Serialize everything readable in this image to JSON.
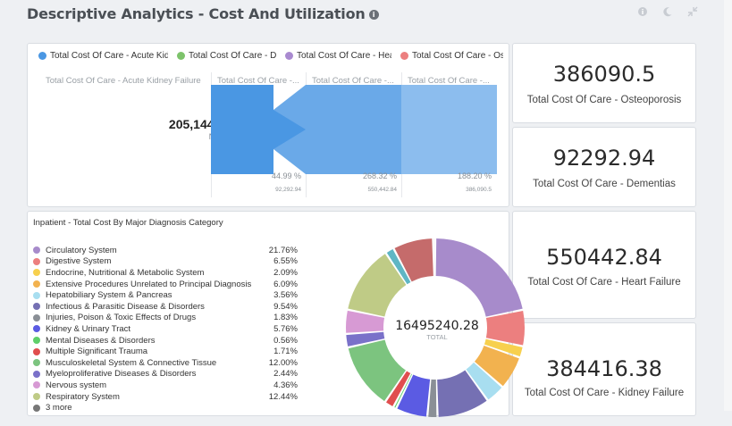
{
  "header": {
    "title": "Descriptive Analytics - Cost And Utilization",
    "info_icon": "i",
    "icons": [
      "info-circle-icon",
      "moon-icon",
      "collapse-icon"
    ]
  },
  "funnel": {
    "legend": [
      {
        "label": "Total Cost Of Care - Acute Kidn",
        "color": "#4a97e3"
      },
      {
        "label": "Total Cost Of Care - De",
        "color": "#7dc36b"
      },
      {
        "label": "Total Cost Of Care - Hear",
        "color": "#a98ad0"
      },
      {
        "label": "Total Cost Of Care - Oste",
        "color": "#ec7f7f"
      }
    ],
    "stage_headers": [
      "Total Cost Of Care - Acute Kidney Failure",
      "Total Cost Of Care -...",
      "Total Cost Of Care -...",
      "Total Cost Of Care -..."
    ],
    "first_value": "205,144.43",
    "first_label": "Name",
    "stages": [
      {
        "pct": "44.99 %",
        "raw": "92,292.94"
      },
      {
        "pct": "268.32 %",
        "raw": "550,442.84"
      },
      {
        "pct": "188.20 %",
        "raw": "386,090.5"
      }
    ]
  },
  "kpis": [
    {
      "value": "386090.5",
      "label": "Total Cost Of Care - Osteoporosis"
    },
    {
      "value": "92292.94",
      "label": "Total Cost Of Care - Dementias"
    },
    {
      "value": "550442.84",
      "label": "Total Cost Of Care - Heart Failure"
    },
    {
      "value": "384416.38",
      "label": "Total Cost Of Care - Kidney Failure"
    }
  ],
  "donut": {
    "title": "Inpatient - Total Cost By Major Diagnosis Category",
    "total": "16495240.28",
    "total_label": "TOTAL",
    "categories": [
      {
        "name": "Circulatory System",
        "value": "21.76%",
        "pct": 21.76,
        "color": "#a78bcb"
      },
      {
        "name": "Digestive System",
        "value": "6.55%",
        "pct": 6.55,
        "color": "#ec7f7f"
      },
      {
        "name": "Endocrine, Nutritional & Metabolic System",
        "value": "2.09%",
        "pct": 2.09,
        "color": "#f7d04e"
      },
      {
        "name": "Extensive Procedures Unrelated to Principal Diagnosis",
        "value": "6.09%",
        "pct": 6.09,
        "color": "#f2b24f"
      },
      {
        "name": "Hepatobiliary System & Pancreas",
        "value": "3.56%",
        "pct": 3.56,
        "color": "#a8def0"
      },
      {
        "name": "Infectious & Parasitic Disease & Disorders",
        "value": "9.54%",
        "pct": 9.54,
        "color": "#7570b3"
      },
      {
        "name": "Injuries, Poison & Toxic Effects of Drugs",
        "value": "1.83%",
        "pct": 1.83,
        "color": "#8a8f96"
      },
      {
        "name": "Kidney & Urinary Tract",
        "value": "5.76%",
        "pct": 5.76,
        "color": "#5b5be3"
      },
      {
        "name": "Mental Diseases & Disorders",
        "value": "0.56%",
        "pct": 0.56,
        "color": "#5fcf6a"
      },
      {
        "name": "Multiple Significant Trauma",
        "value": "1.71%",
        "pct": 1.71,
        "color": "#e04e4e"
      },
      {
        "name": "Musculoskeletal System & Connective Tissue",
        "value": "12.00%",
        "pct": 12.0,
        "color": "#7cc47f"
      },
      {
        "name": "Myeloproliferative Diseases & Disorders",
        "value": "2.44%",
        "pct": 2.44,
        "color": "#7a71c9"
      },
      {
        "name": "Nervous system",
        "value": "4.36%",
        "pct": 4.36,
        "color": "#d79ad4"
      },
      {
        "name": "Respiratory System",
        "value": "12.44%",
        "pct": 12.44,
        "color": "#bfcb86"
      },
      {
        "name": "3 more",
        "value": "",
        "pct": 0,
        "color": "#777777"
      }
    ],
    "remainder": [
      {
        "pct": 1.6,
        "color": "#5fb6c4"
      },
      {
        "pct": 7.3,
        "color": "#c56b6b"
      },
      {
        "pct": 0.4,
        "color": "#999999"
      }
    ]
  }
}
